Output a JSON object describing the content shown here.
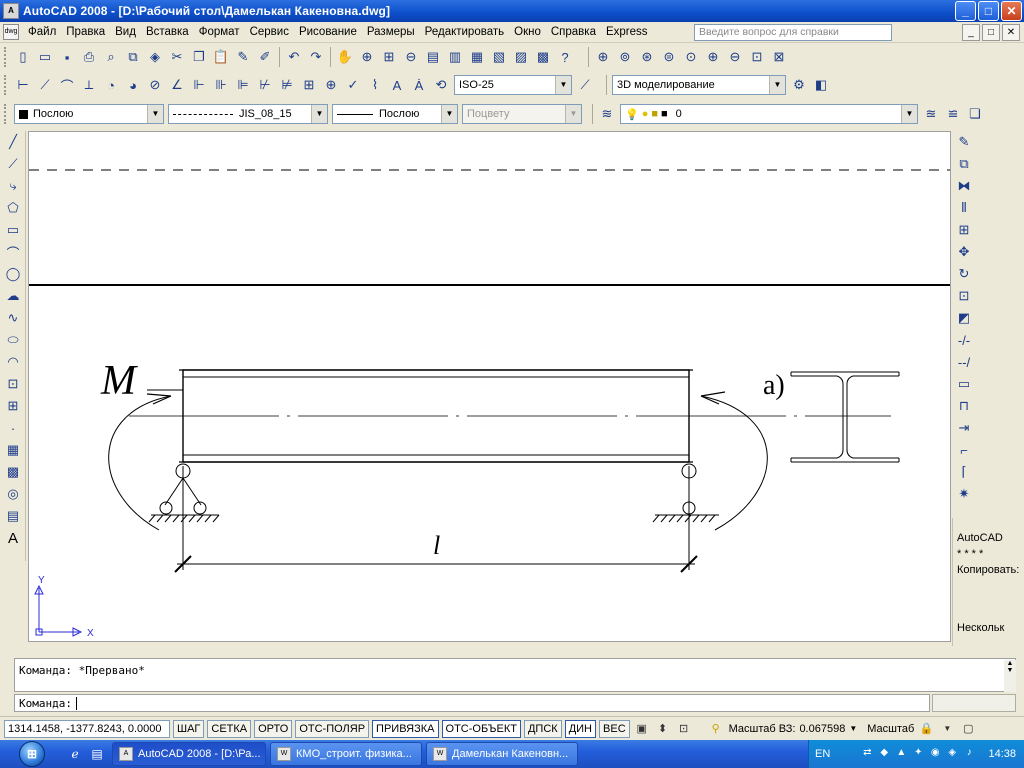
{
  "window": {
    "title": "AutoCAD 2008 - [D:\\Рабочий стол\\Дамелькан Какеновна.dwg]",
    "app_icon_label": "A",
    "controls": {
      "minimize": "_",
      "maximize": "□",
      "close": "✕"
    }
  },
  "menubar": {
    "items": [
      "Файл",
      "Правка",
      "Вид",
      "Вставка",
      "Формат",
      "Сервис",
      "Рисование",
      "Размеры",
      "Редактировать",
      "Окно",
      "Справка",
      "Express"
    ],
    "help_placeholder": "Введите вопрос для справки",
    "doc_controls": [
      "_",
      "□",
      "✕"
    ]
  },
  "toolbars": {
    "standard_icons": [
      "new-icon",
      "open-icon",
      "save-icon",
      "plot-icon",
      "plot-preview-icon",
      "publish-icon",
      "3d-dwf-icon",
      "cut-icon",
      "copy-icon",
      "paste-icon",
      "match-properties-icon",
      "block-editor-icon",
      "undo-icon",
      "redo-icon",
      "pan-icon",
      "zoom-realtime-icon",
      "zoom-window-icon",
      "zoom-previous-icon",
      "properties-icon",
      "design-center-icon",
      "tool-palettes-icon",
      "sheet-set-icon",
      "markup-icon",
      "calculator-icon",
      "help-icon"
    ],
    "dimension_style": "ISO-25",
    "workspace": "3D моделирование",
    "color_value": "Послою",
    "linetype_value": "JIS_08_15",
    "lineweight_value": "Послою",
    "plotstyle_value": "Поцвету",
    "layer_value": "0"
  },
  "drawing": {
    "moment_label": "M",
    "length_label": "l",
    "section_label": "а)",
    "ucs": {
      "x_label": "X",
      "y_label": "Y"
    }
  },
  "side_panel": {
    "lines": [
      "AutoCAD",
      "* * * *",
      "Копировать:",
      "Нескольк"
    ]
  },
  "command": {
    "history": "Команда: *Прервано*",
    "prompt": "Команда:"
  },
  "statusbar": {
    "coordinates": "1314.1458, -1377.8243, 0.0000",
    "toggles": [
      {
        "label": "ШАГ",
        "on": false
      },
      {
        "label": "СЕТКА",
        "on": false
      },
      {
        "label": "ОРТО",
        "on": false
      },
      {
        "label": "ОТС-ПОЛЯР",
        "on": false
      },
      {
        "label": "ПРИВЯЗКА",
        "on": true
      },
      {
        "label": "ОТС-ОБЪЕКТ",
        "on": true
      },
      {
        "label": "ДПСК",
        "on": false
      },
      {
        "label": "ДИН",
        "on": true
      },
      {
        "label": "ВЕС",
        "on": false
      }
    ],
    "annotation_scale_label": "Масштаб ВЗ:",
    "annotation_scale_value": "0.067598",
    "scale_label": "Масштаб"
  },
  "taskbar": {
    "tasks": [
      {
        "label": "AutoCAD 2008 - [D:\\Ра...",
        "active": true
      },
      {
        "label": "КМО_строит. физика...",
        "active": false
      },
      {
        "label": "Дамелькан Какеновн...",
        "active": false
      }
    ],
    "language": "EN",
    "clock": "14:38"
  },
  "colors": {
    "title_bar": "#0d4fc9",
    "taskbar": "#245edb",
    "tray": "#1a76d2",
    "chrome": "#ece9d8"
  }
}
